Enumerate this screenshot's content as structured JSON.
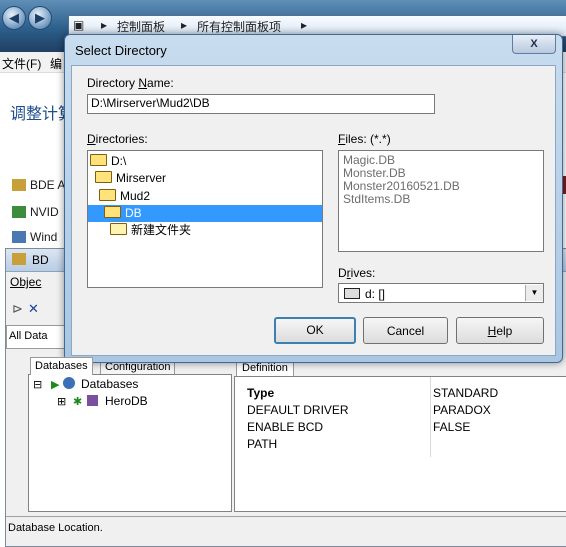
{
  "explorer": {
    "nav_back": "◀",
    "nav_forward": "▶",
    "breadcrumb": [
      "控制面板",
      "所有控制面板项"
    ],
    "menu_file": "文件(F)",
    "menu_edit": "编",
    "page_title": "调整计算",
    "items": [
      "BDE A",
      "NVID",
      "Wind"
    ]
  },
  "bde_window": {
    "title": "BD",
    "menu_object": "Objec",
    "toolbar_label": "All Data",
    "tabs": [
      "Databases",
      "Configuration"
    ],
    "tree": {
      "root": "Databases",
      "child": "HeroDB",
      "expand_root": "⊟",
      "expand_child": "⊞"
    },
    "definition_tab": "Definition",
    "properties": [
      {
        "key": "Type",
        "value": "STANDARD"
      },
      {
        "key": "DEFAULT DRIVER",
        "value": "PARADOX"
      },
      {
        "key": "ENABLE BCD",
        "value": "FALSE"
      },
      {
        "key": "PATH",
        "value": ""
      }
    ],
    "status": "Database Location."
  },
  "dialog": {
    "title": "Select Directory",
    "close_label": "X",
    "directory_name_label_pre": "Directory ",
    "directory_name_label_u": "N",
    "directory_name_label_post": "ame:",
    "directory_name_value": "D:\\Mirserver\\Mud2\\DB",
    "directories_label_u": "D",
    "directories_label_post": "irectories:",
    "directories": [
      "D:\\",
      "Mirserver",
      "Mud2",
      "DB",
      "新建文件夹"
    ],
    "selected_directory": "DB",
    "files_label_u": "F",
    "files_label_post": "iles: (*.*)",
    "files": [
      "Magic.DB",
      "Monster.DB",
      "Monster20160521.DB",
      "StdItems.DB"
    ],
    "drives_label_pre": "D",
    "drives_label_u": "r",
    "drives_label_post": "ives:",
    "drive_value": "d: []",
    "ok_label": "OK",
    "cancel_label": "Cancel",
    "help_label_u": "H",
    "help_label_post": "elp"
  },
  "colors": {
    "selection": "#3399ff",
    "title_link": "#1e4e8c"
  }
}
